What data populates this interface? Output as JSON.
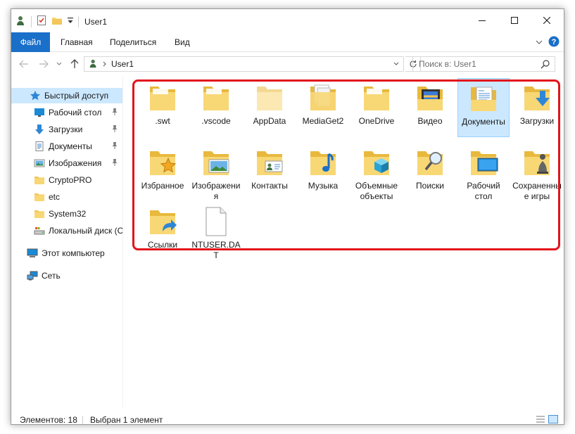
{
  "window": {
    "title": "User1"
  },
  "ribbon": {
    "tabs": [
      "Файл",
      "Главная",
      "Поделиться",
      "Вид"
    ]
  },
  "address": {
    "path": "User1",
    "search_placeholder": "Поиск в: User1"
  },
  "sidebar": {
    "quick_access": "Быстрый доступ",
    "pinned": [
      {
        "label": "Рабочий стол",
        "icon": "desktop-icon",
        "pinned": true
      },
      {
        "label": "Загрузки",
        "icon": "downloads-icon",
        "pinned": true
      },
      {
        "label": "Документы",
        "icon": "documents-icon",
        "pinned": true
      },
      {
        "label": "Изображения",
        "icon": "pictures-icon",
        "pinned": true
      },
      {
        "label": "CryptoPRO",
        "icon": "folder-icon",
        "pinned": false
      },
      {
        "label": "etc",
        "icon": "folder-icon",
        "pinned": false
      },
      {
        "label": "System32",
        "icon": "folder-icon",
        "pinned": false
      },
      {
        "label": "Локальный диск (С",
        "icon": "drive-icon",
        "pinned": false
      }
    ],
    "this_pc": "Этот компьютер",
    "network": "Сеть"
  },
  "content": {
    "items": [
      {
        "name": ".swt",
        "icon": "folder-icon"
      },
      {
        "name": ".vscode",
        "icon": "folder-icon"
      },
      {
        "name": "AppData",
        "icon": "folder-hidden-icon"
      },
      {
        "name": "MediaGet2",
        "icon": "folder-docs-icon"
      },
      {
        "name": "OneDrive",
        "icon": "folder-icon"
      },
      {
        "name": "Видео",
        "icon": "videos-folder-icon"
      },
      {
        "name": "Документы",
        "icon": "documents-folder-icon",
        "selected": true
      },
      {
        "name": "Загрузки",
        "icon": "downloads-folder-icon"
      },
      {
        "name": "Избранное",
        "icon": "favorites-folder-icon"
      },
      {
        "name": "Изображения",
        "icon": "pictures-folder-icon"
      },
      {
        "name": "Контакты",
        "icon": "contacts-folder-icon"
      },
      {
        "name": "Музыка",
        "icon": "music-folder-icon"
      },
      {
        "name": "Объемные объекты",
        "icon": "3d-objects-folder-icon"
      },
      {
        "name": "Поиски",
        "icon": "searches-folder-icon"
      },
      {
        "name": "Рабочий стол",
        "icon": "desktop-folder-icon"
      },
      {
        "name": "Сохраненные игры",
        "icon": "saved-games-folder-icon"
      },
      {
        "name": "Ссылки",
        "icon": "links-folder-icon"
      },
      {
        "name": "NTUSER.DAT",
        "icon": "file-icon"
      }
    ]
  },
  "status": {
    "items_count": "Элементов: 18",
    "selected": "Выбран 1 элемент"
  },
  "colors": {
    "accent": "#1a6fc9",
    "selection": "#cce8ff",
    "highlight": "#e2141c",
    "folder": "#f8d775"
  }
}
